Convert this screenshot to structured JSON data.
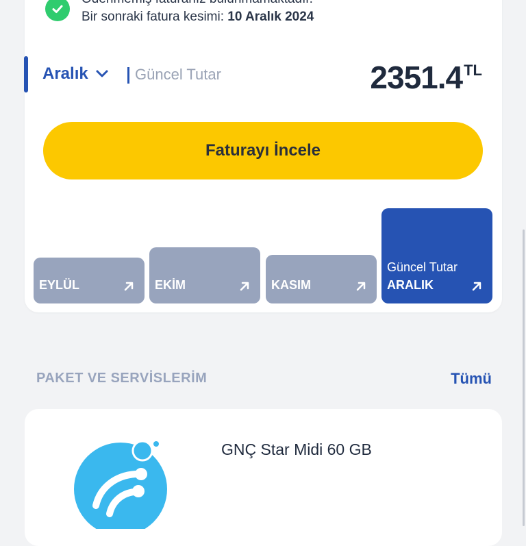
{
  "status": {
    "line1": "Ödenmemiş faturanız bulunmamaktadır.",
    "next_bill_prefix": "Bir sonraki fatura kesimi: ",
    "next_bill_date": "10 Aralık 2024",
    "icon": "check-icon",
    "icon_color": "#2fcc6e"
  },
  "bill": {
    "selected_month": "Aralık",
    "current_label": "Güncel Tutar",
    "amount": "2351.4",
    "currency": "TL",
    "button_label": "Faturayı İncele"
  },
  "months": [
    {
      "name": "EYLÜL",
      "sub": "",
      "level": 0.48
    },
    {
      "name": "EKİM",
      "sub": "",
      "level": 0.59
    },
    {
      "name": "KASIM",
      "sub": "",
      "level": 0.51
    },
    {
      "name": "ARALIK",
      "sub": "Güncel Tutar",
      "level": 1.0,
      "active": true
    }
  ],
  "packages": {
    "section_title": "PAKET VE SERVİSLERİM",
    "see_all": "Tümü",
    "items": [
      {
        "name": "GNÇ Star Midi 60 GB",
        "icon": "turkcell-logo-icon"
      }
    ]
  },
  "colors": {
    "accent": "#2653b3",
    "button": "#fcc800",
    "inactive_bar": "#98a4bd",
    "logo": "#3ab8ee"
  }
}
